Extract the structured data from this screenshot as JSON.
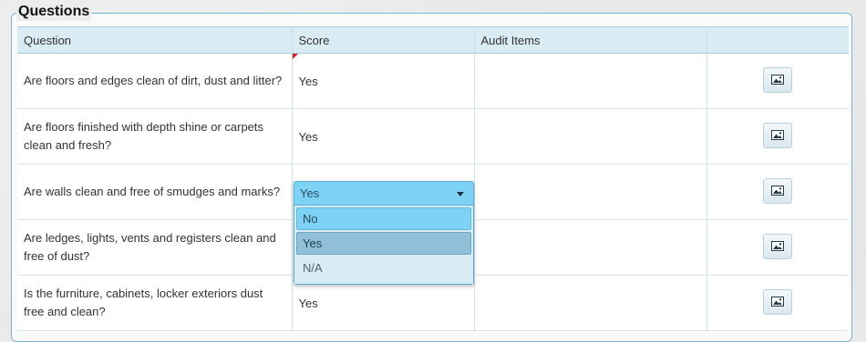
{
  "section": {
    "legend": "Questions"
  },
  "table": {
    "headers": [
      "Question",
      "Score",
      "Audit Items",
      ""
    ],
    "rows": [
      {
        "question": "Are floors and edges clean of dirt, dust and litter?",
        "score": "Yes",
        "audit_items": ""
      },
      {
        "question": "Are floors finished with depth shine or carpets clean and fresh?",
        "score": "Yes",
        "audit_items": ""
      },
      {
        "question": "Are walls clean and free of smudges and marks?",
        "score": "",
        "audit_items": ""
      },
      {
        "question": "Are ledges, lights, vents and registers clean and free of dust?",
        "score": "",
        "audit_items": ""
      },
      {
        "question": "Is the furniture, cabinets, locker exteriors dust free and clean?",
        "score": "Yes",
        "audit_items": ""
      }
    ]
  },
  "dropdown": {
    "selected": "Yes",
    "options": [
      "No",
      "Yes",
      "N/A"
    ],
    "hover_option": "No"
  },
  "icons": {
    "image_button": "image-icon",
    "dropdown_arrow": "triangle-down-icon"
  }
}
